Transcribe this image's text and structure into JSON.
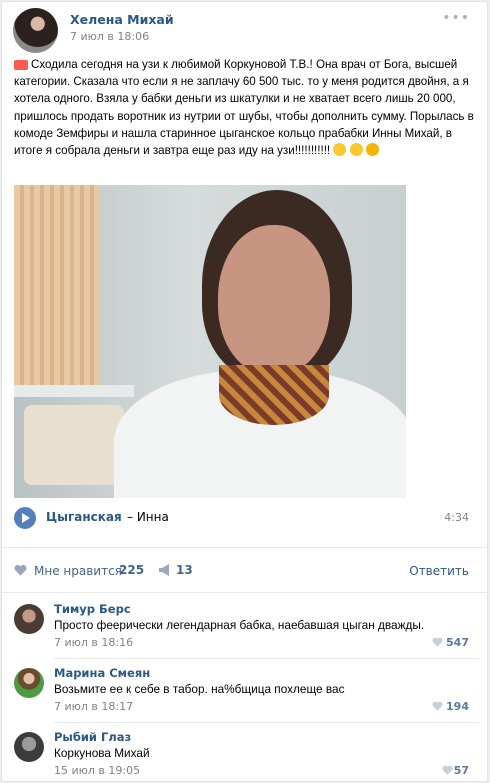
{
  "post": {
    "author": "Хелена Михай",
    "date": "7 июл в 18:06",
    "more": "•••",
    "text": "Сходила сегодня на узи к любимой Коркуновой Т.В.! Она врач от Бога, высшей категории. Сказала что если я не заплачу 60 500 тыс. то у меня родится двойня, а я хотела одного. Взяла у бабки деньги из шкатулки и не хватает всего лишь 20 000, пришлось продать воротник из нутрии от шубы, чтобы дополнить сумму. Порылась в комоде Земфиры и нашла старинное цыганское кольцо прабабки Инны Михай, в итоге я собрала деньги и завтра еще раз иду на узи!!!!!!!!!!!",
    "emoji_icons": [
      "ambulance-emoji",
      "chick-emoji",
      "chick-emoji",
      "grin-emoji"
    ]
  },
  "audio": {
    "artist": "Цыганская",
    "separator_title": "– Инна",
    "duration": "4:34"
  },
  "actions": {
    "like_label": "Мне нравится",
    "like_count": "225",
    "share_count": "13",
    "reply_label": "Ответить"
  },
  "comments": [
    {
      "author": "Тимур Берс",
      "text": "Просто феерически легендарная бабка, наебавшая цыган дважды.",
      "date": "7 июл в 18:16",
      "likes": "547"
    },
    {
      "author": "Марина Смеян",
      "text": "Возьмите ее к себе в табор. на%бщица похлеще вас",
      "date": "7 июл в 18:17",
      "likes": "194"
    },
    {
      "author": "Рыбий Глаз",
      "text": "Коркунова Михай",
      "date": "15 июл в 19:05",
      "likes": "57"
    }
  ],
  "colors": {
    "link": "#2a5885",
    "accent": "#5181b8",
    "muted": "#828282"
  }
}
